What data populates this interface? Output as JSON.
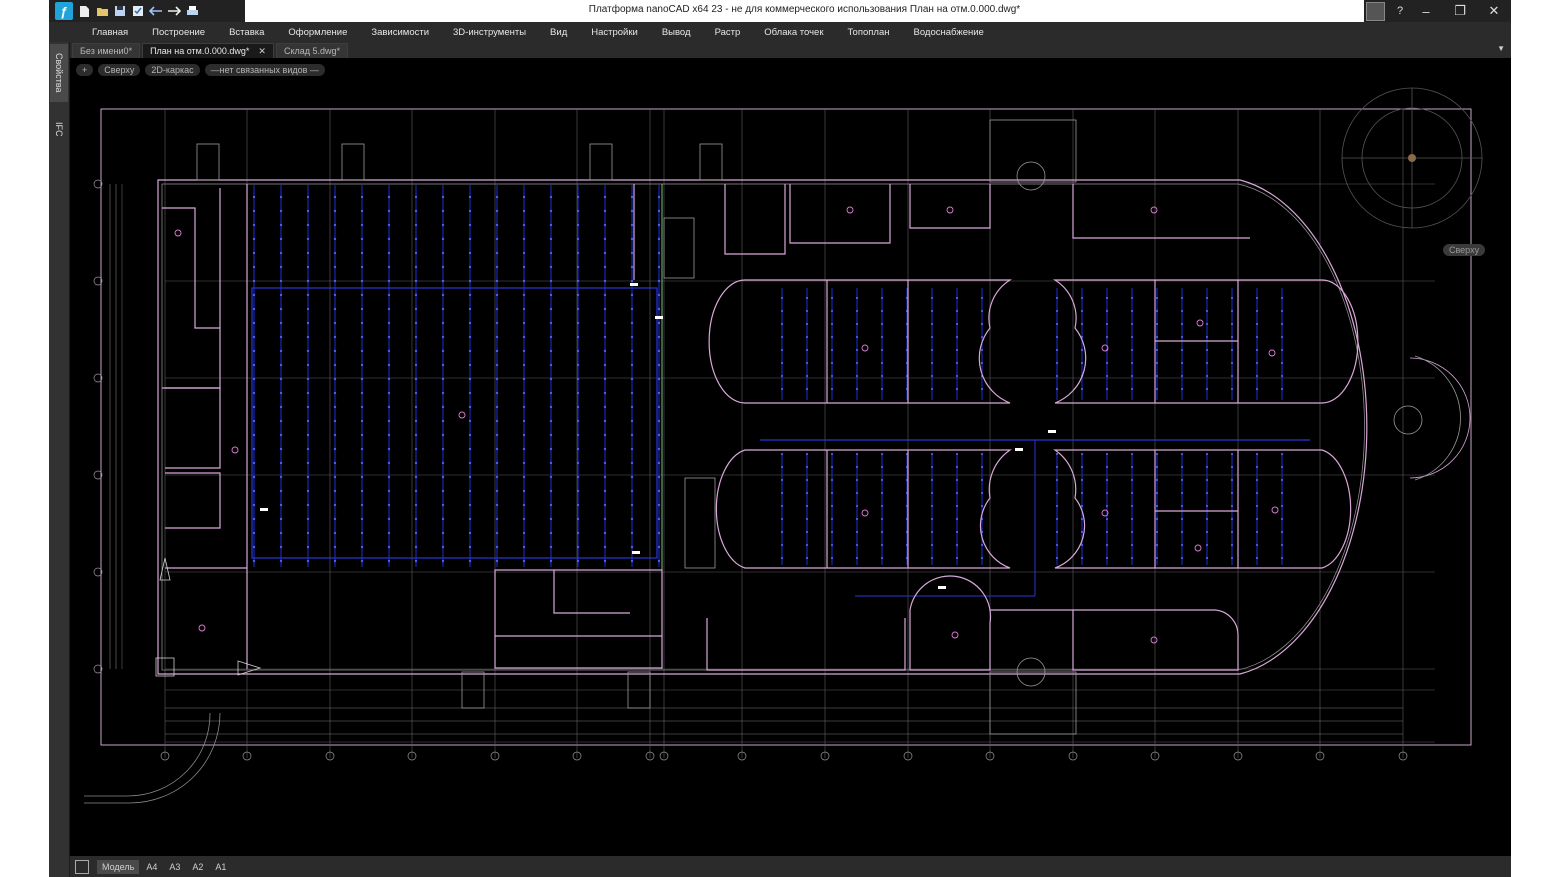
{
  "window": {
    "title": "Платформа nanoCAD x64 23 - не для коммерческого использования План на отм.0.000.dwg*",
    "logo": "nanoCAD-logo-icon",
    "help_label": "?"
  },
  "quick_access": [
    "new-file-icon",
    "open-icon",
    "save-icon",
    "save-all-icon",
    "undo-icon",
    "redo-icon",
    "print-icon"
  ],
  "menu": [
    "Главная",
    "Построение",
    "Вставка",
    "Оформление",
    "Зависимости",
    "3D-инструменты",
    "Вид",
    "Настройки",
    "Вывод",
    "Растр",
    "Облака точек",
    "Топоплан",
    "Водоснабжение"
  ],
  "side_tabs": [
    "Свойства",
    "IFC"
  ],
  "doc_tabs": [
    {
      "label": "Без имени0*",
      "active": false
    },
    {
      "label": "План на отм.0.000.dwg*",
      "active": true,
      "close": "✕"
    },
    {
      "label": "Склад 5.dwg*",
      "active": false
    }
  ],
  "view_controls": {
    "plus": "+",
    "view": "Сверху",
    "style": "2D-каркас",
    "linked": "—нет связанных видов —"
  },
  "viewcube_label": "Сверху",
  "layout_tabs": [
    {
      "label": "Модель",
      "active": true
    },
    {
      "label": "А4",
      "active": false
    },
    {
      "label": "А3",
      "active": false
    },
    {
      "label": "А2",
      "active": false
    },
    {
      "label": "А1",
      "active": false
    }
  ],
  "colors": {
    "background": "#000000",
    "walls": "#d9a8d8",
    "ceiling_grid": "#1e2fd0",
    "axes": "#9a9a9a",
    "ui_dark": "#2b2b2b"
  }
}
